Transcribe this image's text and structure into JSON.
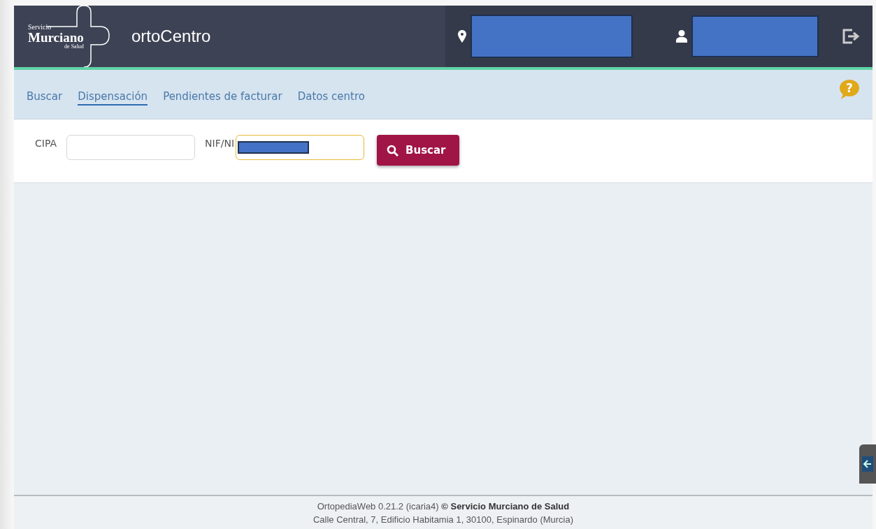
{
  "header": {
    "logo": {
      "line_1": "Servicio",
      "line_2": "Murciano",
      "line_3": "de Salud"
    },
    "app_title": "ortoCentro"
  },
  "nav": {
    "tabs": [
      {
        "label": "Buscar",
        "selected": false
      },
      {
        "label": "Dispensación",
        "selected": true
      },
      {
        "label": "Pendientes de facturar",
        "selected": false
      },
      {
        "label": "Datos centro",
        "selected": false
      }
    ],
    "help": "?"
  },
  "search": {
    "fields": [
      {
        "label": "CIPA",
        "redacted": false
      },
      {
        "label": "NIF/NI",
        "redacted": true
      }
    ],
    "button": "Buscar"
  },
  "footer": {
    "line_1": "OrtopediaWeb 0.21.2 (icaria4) **© Servicio Murciano de Salud**",
    "line_2": "Calle Central, 7, Edificio Habitamia 1, 30100, Espinardo (Murcia)"
  }
}
